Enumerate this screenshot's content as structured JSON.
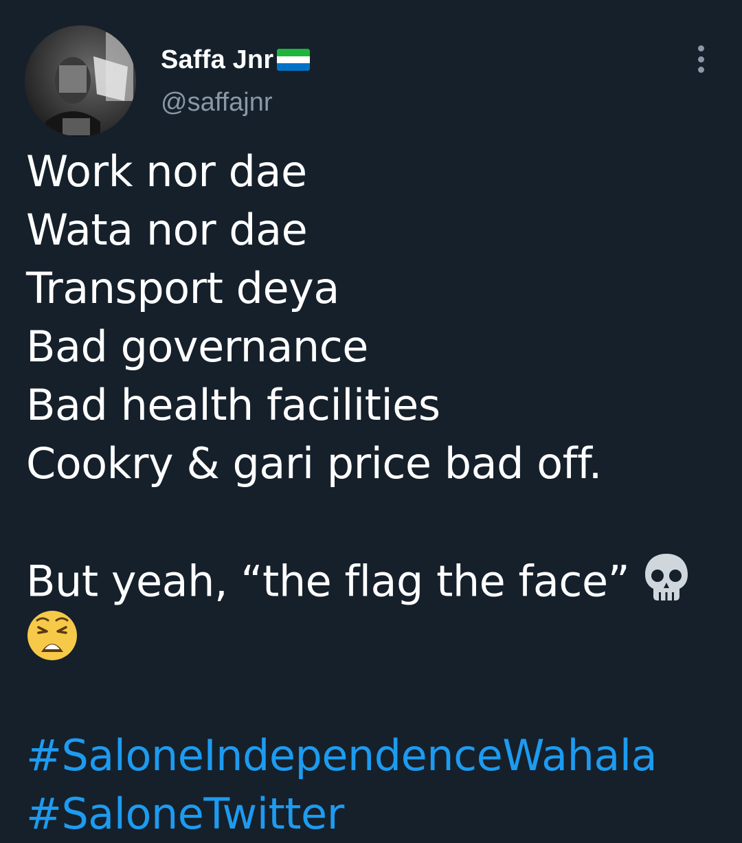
{
  "author": {
    "display_name": "Saffa Jnr",
    "handle": "@saffajnr",
    "flag_icon": "sierra-leone-flag-icon",
    "avatar_icon": "profile-photo"
  },
  "menu": {
    "icon": "more-vertical-icon"
  },
  "tweet": {
    "lines": [
      "Work nor dae",
      "Wata nor dae",
      "Transport deya",
      "Bad governance",
      "Bad health facilities",
      "Cookry & gari price bad off."
    ],
    "closing": "But yeah, “the flag the face”",
    "emojis": [
      "skull-emoji",
      "weary-face-emoji"
    ],
    "hashtags": [
      "#SaloneIndependenceWahala",
      "#SaloneTwitter"
    ]
  },
  "colors": {
    "background": "#15202b",
    "text": "#ffffff",
    "secondary": "#8b98a5",
    "link": "#1d9bf0"
  }
}
